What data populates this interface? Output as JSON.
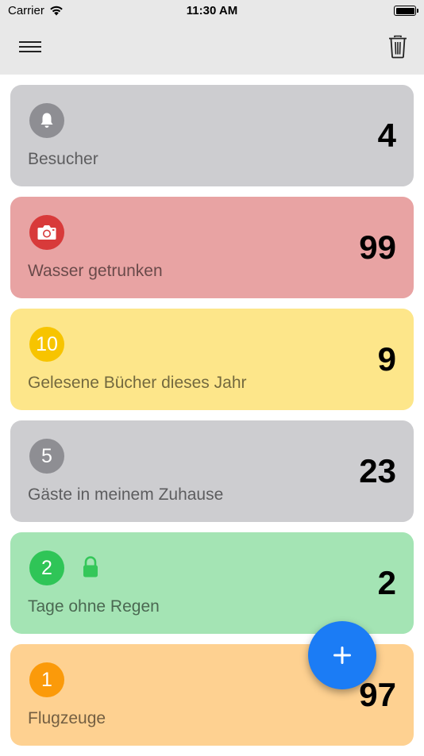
{
  "status_bar": {
    "carrier": "Carrier",
    "time": "11:30 AM"
  },
  "counters": [
    {
      "title": "Besucher",
      "count": "4",
      "badge": "",
      "icon": "bell-icon",
      "card_color": "#cdcdd0",
      "badge_color": "#8e8e93"
    },
    {
      "title": "Wasser getrunken",
      "count": "99",
      "badge": "",
      "icon": "camera-icon",
      "card_color": "#e8a3a3",
      "badge_color": "#d83a3a"
    },
    {
      "title": "Gelesene Bücher dieses Jahr",
      "count": "9",
      "badge": "10",
      "icon": "",
      "card_color": "#fde68a",
      "badge_color": "#f7c400"
    },
    {
      "title": "Gäste in meinem Zuhause",
      "count": "23",
      "badge": "5",
      "icon": "",
      "card_color": "#cdcdd0",
      "badge_color": "#8e8e93"
    },
    {
      "title": "Tage ohne Regen",
      "count": "2",
      "badge": "2",
      "icon": "lock-icon",
      "card_color": "#a4e4b4",
      "badge_color": "#2fc557"
    },
    {
      "title": "Flugzeuge",
      "count": "97",
      "badge": "1",
      "icon": "",
      "card_color": "#fed191",
      "badge_color": "#fb9a0a"
    }
  ],
  "colors": {
    "accent": "#1b7cf5",
    "lock": "#34c759"
  }
}
